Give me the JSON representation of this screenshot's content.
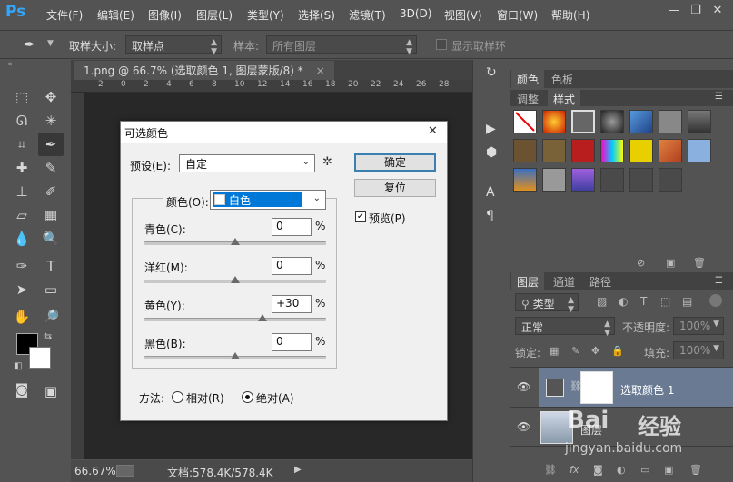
{
  "app": {
    "logo": "Ps"
  },
  "menu": [
    "文件(F)",
    "编辑(E)",
    "图像(I)",
    "图层(L)",
    "类型(Y)",
    "选择(S)",
    "滤镜(T)",
    "3D(D)",
    "视图(V)",
    "窗口(W)",
    "帮助(H)"
  ],
  "window_controls": {
    "minimize": "—",
    "restore": "❐",
    "close": "✕"
  },
  "options": {
    "sample_size_label": "取样大小:",
    "sample_size_value": "取样点",
    "sample_label": "样本:",
    "sample_value": "所有图层",
    "show_ring_label": "显示取样环"
  },
  "document": {
    "tab_title": "1.png @ 66.7% (选取颜色 1, 图层蒙版/8) *",
    "close": "×",
    "ruler_ticks": [
      "2",
      "0",
      "2",
      "4",
      "6",
      "8",
      "10",
      "12",
      "14",
      "16",
      "18",
      "20",
      "22",
      "24",
      "26",
      "28"
    ],
    "zoom": "66.67%",
    "doc_size": "文档:578.4K/578.4K"
  },
  "dialog": {
    "title": "可选颜色",
    "close": "✕",
    "preset_label": "预设(E):",
    "preset_value": "自定",
    "ok_label": "确定",
    "reset_label": "复位",
    "preview_label": "预览(P)",
    "preview_checked": true,
    "colors_label": "颜色(O):",
    "colors_value": "白色",
    "sliders": [
      {
        "label": "青色(C):",
        "value": "0",
        "percent": "%",
        "position": 0.5
      },
      {
        "label": "洋红(M):",
        "value": "0",
        "percent": "%",
        "position": 0.5
      },
      {
        "label": "黄色(Y):",
        "value": "+30",
        "percent": "%",
        "position": 0.65
      },
      {
        "label": "黑色(B):",
        "value": "0",
        "percent": "%",
        "position": 0.5
      }
    ],
    "method_label": "方法:",
    "method_relative": "相对(R)",
    "method_absolute": "绝对(A)",
    "method_selected": "absolute"
  },
  "panels": {
    "color_tabs": [
      "颜色",
      "色板"
    ],
    "style_tabs": [
      "调整",
      "样式"
    ],
    "layer_tabs": [
      "图层",
      "通道",
      "路径"
    ],
    "kind_filter": "类型",
    "blend_mode": "正常",
    "opacity_label": "不透明度:",
    "opacity_value": "100%",
    "lock_label": "锁定:",
    "fill_label": "填充:",
    "fill_value": "100%",
    "layers": [
      {
        "name": "选取颜色 1",
        "selected": true
      },
      {
        "name": "图层",
        "selected": false
      }
    ],
    "footer_icons": [
      "link-icon",
      "fx-icon",
      "mask-icon",
      "adjustment-icon",
      "folder-icon",
      "new-layer-icon",
      "trash-icon"
    ]
  },
  "watermark": {
    "brand": "Bai",
    "brand2": "经验",
    "url": "jingyan.baidu.com"
  },
  "colors": {
    "ps_blue": "#31a8ff",
    "selected_layer": "#697a92",
    "dialog_highlight": "#0078d7"
  }
}
